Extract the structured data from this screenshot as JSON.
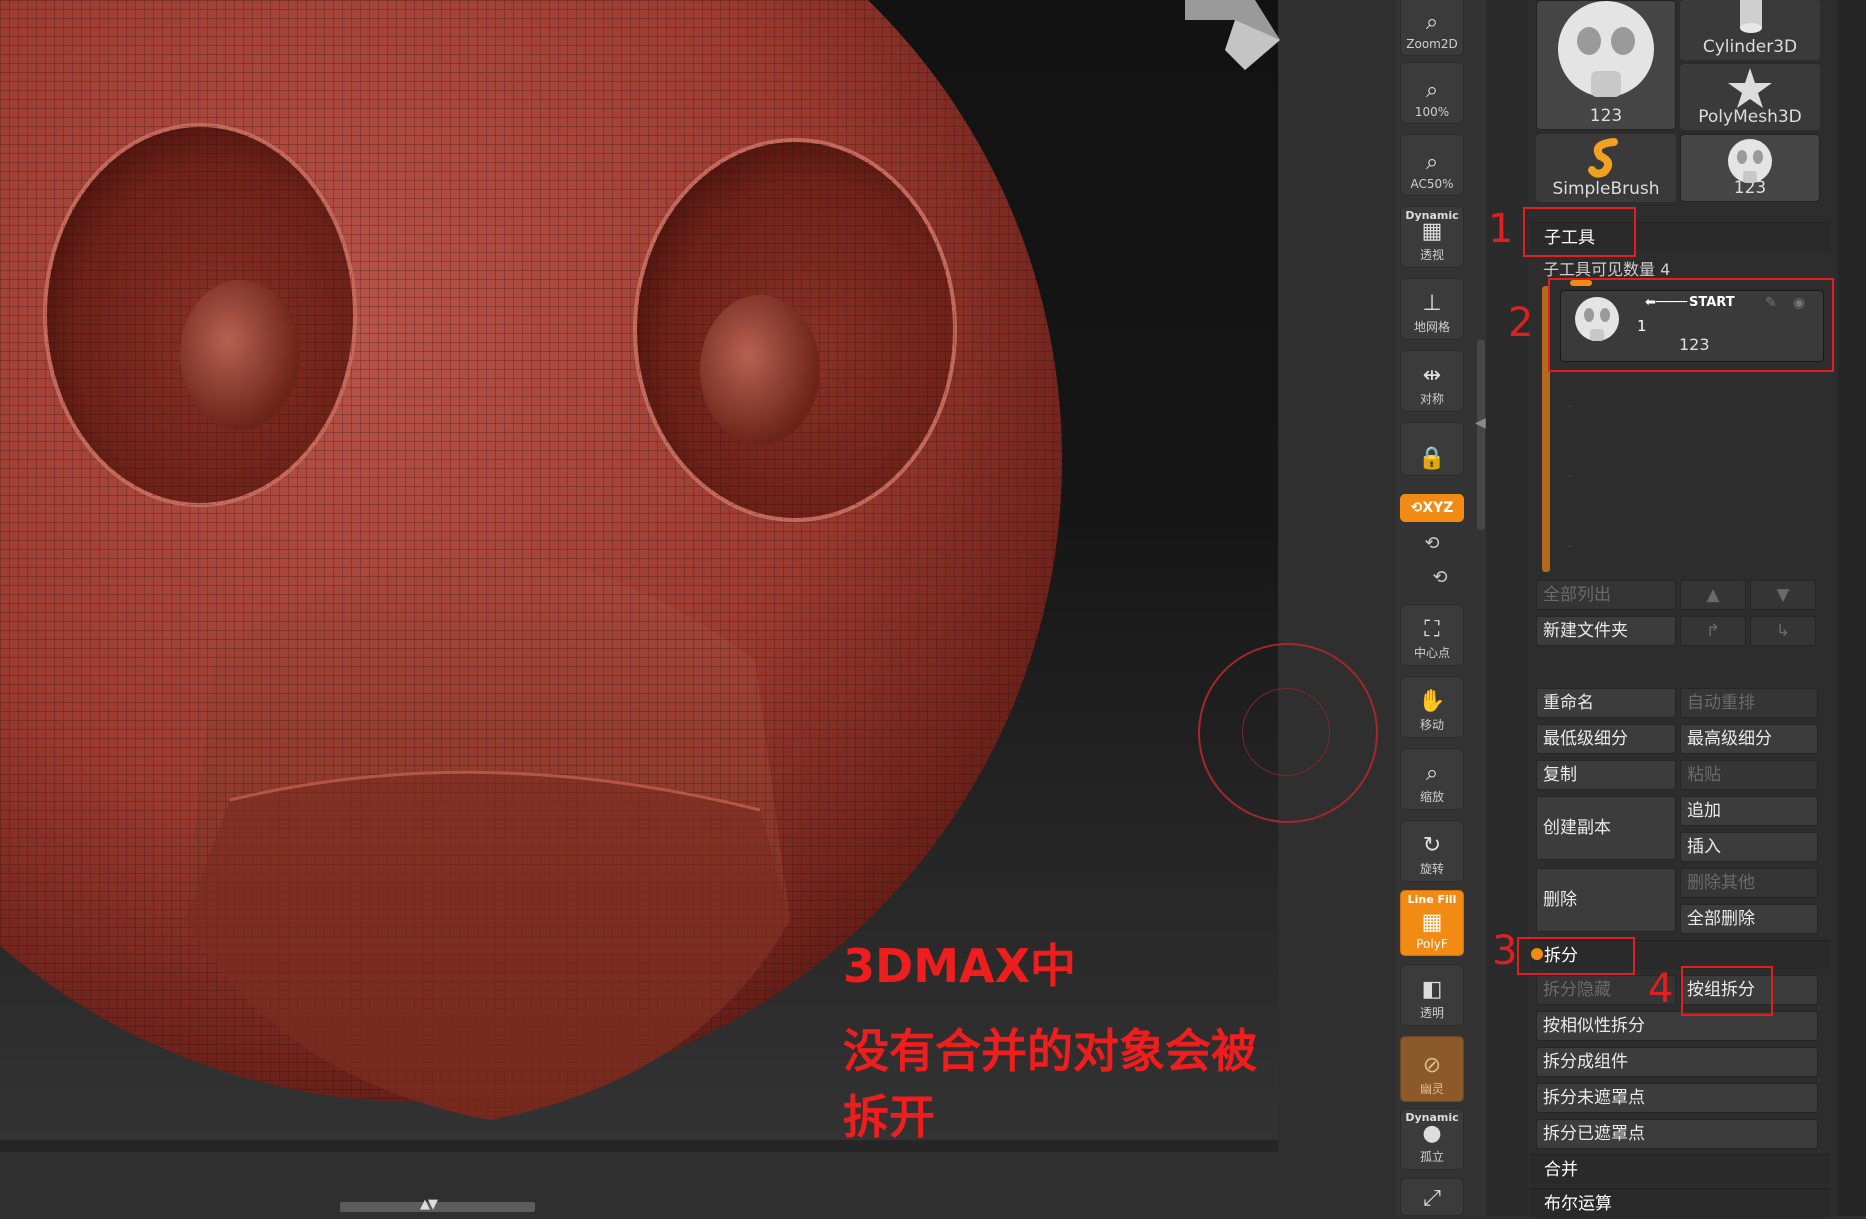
{
  "viewport": {
    "annotation_line1": "3DMAX中",
    "annotation_line2": "没有合并的对象会被拆开"
  },
  "shelf": {
    "zoom2d": "Zoom2D",
    "actual": "100%",
    "ac50": "AC50%",
    "persp_dynamic": "Dynamic",
    "persp": "透视",
    "floor": "地网格",
    "sym": "对称",
    "lock": "",
    "xyz": "XYZ",
    "center": "中心点",
    "move": "移动",
    "scale": "缩放",
    "rotate": "旋转",
    "polyf_top": "Line Fill",
    "polyf": "PolyF",
    "transp": "透明",
    "ghost": "幽灵",
    "solo_dynamic": "Dynamic",
    "solo": "孤立",
    "accent_color": "#f28b14"
  },
  "thumbnails": [
    {
      "label": "123",
      "icon": "head-icon"
    },
    {
      "label": "Cylinder3D",
      "icon": "cylinder-icon"
    },
    {
      "label": "PolyMesh3D",
      "icon": "star-icon"
    },
    {
      "label": "SimpleBrush",
      "icon": "simplebrush-icon"
    },
    {
      "label": "123",
      "icon": "head-icon"
    }
  ],
  "subtool": {
    "title": "子工具",
    "visible_count": "子工具可见数量 4",
    "item_number": "1",
    "item_start": "START",
    "item_name": "123"
  },
  "buttons": {
    "list_all": "全部列出",
    "new_folder": "新建文件夹",
    "rename": "重命名",
    "auto_reorder": "自动重排",
    "lowest_sub": "最低级细分",
    "highest_sub": "最高级细分",
    "copy": "复制",
    "paste": "粘贴",
    "duplicate": "创建副本",
    "append": "追加",
    "insert": "插入",
    "delete": "删除",
    "delete_other": "删除其他",
    "delete_all": "全部删除"
  },
  "split": {
    "title": "拆分",
    "split_hidden": "拆分隐藏",
    "groups_split": "按组拆分",
    "split_similar": "按相似性拆分",
    "split_to_parts": "拆分成组件",
    "split_unmasked": "拆分未遮罩点",
    "split_masked": "拆分已遮罩点"
  },
  "sections": {
    "merge": "合并",
    "boolean": "布尔运算"
  },
  "markers": {
    "m1": "1",
    "m2": "2",
    "m3": "3",
    "m4": "4"
  }
}
